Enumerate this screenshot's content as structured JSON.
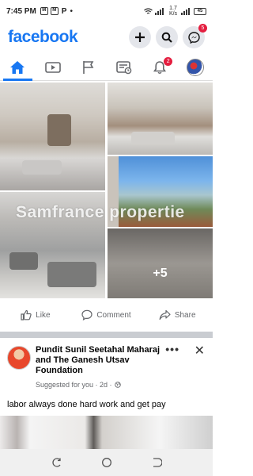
{
  "status_bar": {
    "time": "7:45 PM",
    "icons": [
      "message-icon",
      "message-icon",
      "parking-icon",
      "dot-icon"
    ],
    "icon_letters": [
      "M",
      "M"
    ],
    "p_label": "P",
    "dot": "•",
    "speed": "1.7 K/s",
    "battery": "45"
  },
  "header": {
    "brand": "facebook",
    "messenger_badge": "5"
  },
  "tabs": [
    {
      "name": "home",
      "active": true
    },
    {
      "name": "watch"
    },
    {
      "name": "pages"
    },
    {
      "name": "marketplace"
    },
    {
      "name": "notifications",
      "badge": "2"
    },
    {
      "name": "menu"
    }
  ],
  "post1": {
    "watermark": "Samfrance propertie",
    "more_photos": "+5",
    "actions": {
      "like": "Like",
      "comment": "Comment",
      "share": "Share"
    }
  },
  "post2": {
    "author": "Pundit Sunil Seetahal Maharaj and The Ganesh Utsav Foundation",
    "meta": "Suggested for you · 2d ·",
    "text": "labor always done hard work and get pay",
    "more": "•••",
    "close": "✕"
  },
  "colors": {
    "brand": "#1877f2",
    "badge": "#e41e3f"
  }
}
